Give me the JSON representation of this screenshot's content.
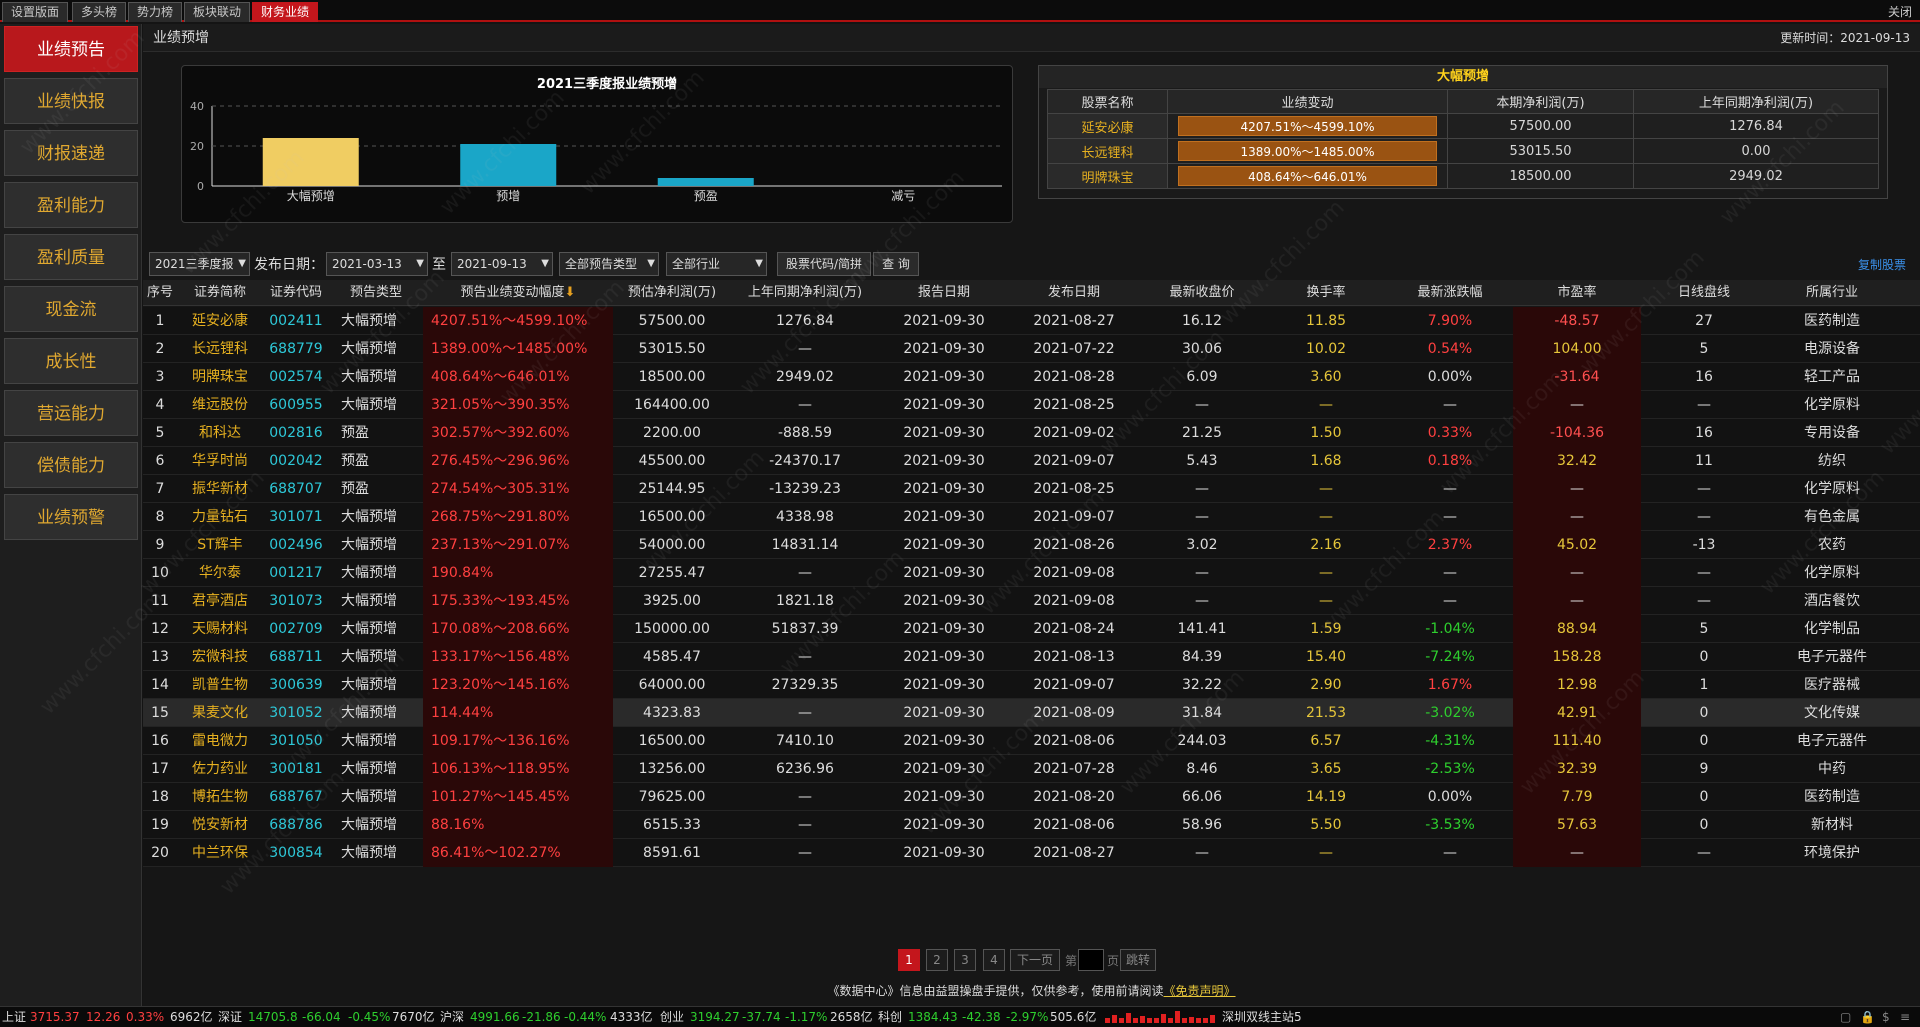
{
  "top_tabs": [
    {
      "label": "设置版面"
    },
    {
      "label": "多头榜"
    },
    {
      "label": "势力榜"
    },
    {
      "label": "板块联动"
    },
    {
      "label": "财务业绩"
    }
  ],
  "close_label": "关闭",
  "sidebar": [
    {
      "label": "业绩预告"
    },
    {
      "label": "业绩快报"
    },
    {
      "label": "财报速递"
    },
    {
      "label": "盈利能力"
    },
    {
      "label": "盈利质量"
    },
    {
      "label": "现金流"
    },
    {
      "label": "成长性"
    },
    {
      "label": "营运能力"
    },
    {
      "label": "偿债能力"
    },
    {
      "label": "业绩预警"
    }
  ],
  "page_title": "业绩预增",
  "update_time": "更新时间：2021-09-13",
  "watermark": "www.cfchi.com",
  "chart_data": {
    "type": "bar",
    "title": "2021三季度报业绩预增",
    "categories": [
      "大幅预增",
      "预增",
      "预盈",
      "减亏"
    ],
    "values": [
      24,
      21,
      4,
      0
    ],
    "colors": [
      "#f0cd62",
      "#1aa6c8",
      "#1aa6c8",
      "#1aa6c8"
    ],
    "ylim": [
      0,
      40
    ],
    "yticks": [
      "0",
      "20",
      "40"
    ],
    "grid": true
  },
  "summary": {
    "title": "大幅预增",
    "headers": [
      "股票名称",
      "业绩变动",
      "本期净利润(万)",
      "上年同期净利润(万)"
    ],
    "rows": [
      {
        "name": "延安必康",
        "change": "4207.51%～4599.10%",
        "profit": "57500.00",
        "prev": "1276.84",
        "fill": 1.0
      },
      {
        "name": "长远锂科",
        "change": "1389.00%～1485.00%",
        "profit": "53015.50",
        "prev": "0.00",
        "fill": 1.0
      },
      {
        "name": "明牌珠宝",
        "change": "408.64%～646.01%",
        "profit": "18500.00",
        "prev": "2949.02",
        "fill": 1.0
      }
    ]
  },
  "filters": {
    "period": "2021三季度报",
    "date_label": "发布日期：",
    "date_from": "2021-03-13",
    "to_label": "至",
    "date_to": "2021-09-13",
    "type": "全部预告类型",
    "industry": "全部行业",
    "search_placeholder": "股票代码/简拼",
    "query_label": "查 询",
    "copy_label": "复制股票"
  },
  "table_headers": [
    "序号",
    "证券简称",
    "证券代码",
    "预告类型",
    "预告业绩变动幅度",
    "预估净利润(万)",
    "上年同期净利润(万)",
    "报告日期",
    "发布日期",
    "最新收盘价",
    "换手率",
    "最新涨跌幅",
    "市盈率",
    "日线盘线",
    "所属行业"
  ],
  "sort_arrow": "⬇",
  "rows": [
    {
      "idx": "1",
      "name": "延安必康",
      "code": "002411",
      "type": "大幅预增",
      "range": "4207.51%～4599.10%",
      "est": "57500.00",
      "prev": "1276.84",
      "rdate": "2021-09-30",
      "pdate": "2021-08-27",
      "close": "16.12",
      "turn": "11.85",
      "chg": "7.90%",
      "dir": "up",
      "pe": "-48.57",
      "days": "27",
      "ind": "医药制造"
    },
    {
      "idx": "2",
      "name": "长远锂科",
      "code": "688779",
      "type": "大幅预增",
      "range": "1389.00%～1485.00%",
      "est": "53015.50",
      "prev": "—",
      "rdate": "2021-09-30",
      "pdate": "2021-07-22",
      "close": "30.06",
      "turn": "10.02",
      "chg": "0.54%",
      "dir": "up",
      "pe": "104.00",
      "days": "5",
      "ind": "电源设备"
    },
    {
      "idx": "3",
      "name": "明牌珠宝",
      "code": "002574",
      "type": "大幅预增",
      "range": "408.64%～646.01%",
      "est": "18500.00",
      "prev": "2949.02",
      "rdate": "2021-09-30",
      "pdate": "2021-08-28",
      "close": "6.09",
      "turn": "3.60",
      "chg": "0.00%",
      "dir": "flat",
      "pe": "-31.64",
      "days": "16",
      "ind": "轻工产品"
    },
    {
      "idx": "4",
      "name": "维远股份",
      "code": "600955",
      "type": "大幅预增",
      "range": "321.05%～390.35%",
      "est": "164400.00",
      "prev": "—",
      "rdate": "2021-09-30",
      "pdate": "2021-08-25",
      "close": "—",
      "turn": "—",
      "chg": "—",
      "dir": "flat",
      "pe": "—",
      "days": "—",
      "ind": "化学原料"
    },
    {
      "idx": "5",
      "name": "和科达",
      "code": "002816",
      "type": "预盈",
      "range": "302.57%～392.60%",
      "est": "2200.00",
      "prev": "-888.59",
      "rdate": "2021-09-30",
      "pdate": "2021-09-02",
      "close": "21.25",
      "turn": "1.50",
      "chg": "0.33%",
      "dir": "up",
      "pe": "-104.36",
      "days": "16",
      "ind": "专用设备"
    },
    {
      "idx": "6",
      "name": "华孚时尚",
      "code": "002042",
      "type": "预盈",
      "range": "276.45%～296.96%",
      "est": "45500.00",
      "prev": "-24370.17",
      "rdate": "2021-09-30",
      "pdate": "2021-09-07",
      "close": "5.43",
      "turn": "1.68",
      "chg": "0.18%",
      "dir": "up",
      "pe": "32.42",
      "days": "11",
      "ind": "纺织"
    },
    {
      "idx": "7",
      "name": "振华新材",
      "code": "688707",
      "type": "预盈",
      "range": "274.54%～305.31%",
      "est": "25144.95",
      "prev": "-13239.23",
      "rdate": "2021-09-30",
      "pdate": "2021-08-25",
      "close": "—",
      "turn": "—",
      "chg": "—",
      "dir": "flat",
      "pe": "—",
      "days": "—",
      "ind": "化学原料"
    },
    {
      "idx": "8",
      "name": "力量钻石",
      "code": "301071",
      "type": "大幅预增",
      "range": "268.75%～291.80%",
      "est": "16500.00",
      "prev": "4338.98",
      "rdate": "2021-09-30",
      "pdate": "2021-09-07",
      "close": "—",
      "turn": "—",
      "chg": "—",
      "dir": "flat",
      "pe": "—",
      "days": "—",
      "ind": "有色金属"
    },
    {
      "idx": "9",
      "name": "ST辉丰",
      "code": "002496",
      "type": "大幅预增",
      "range": "237.13%～291.07%",
      "est": "54000.00",
      "prev": "14831.14",
      "rdate": "2021-09-30",
      "pdate": "2021-08-26",
      "close": "3.02",
      "turn": "2.16",
      "chg": "2.37%",
      "dir": "up",
      "pe": "45.02",
      "days": "-13",
      "ind": "农药"
    },
    {
      "idx": "10",
      "name": "华尔泰",
      "code": "001217",
      "type": "大幅预增",
      "range": "190.84%",
      "est": "27255.47",
      "prev": "—",
      "rdate": "2021-09-30",
      "pdate": "2021-09-08",
      "close": "—",
      "turn": "—",
      "chg": "—",
      "dir": "flat",
      "pe": "—",
      "days": "—",
      "ind": "化学原料"
    },
    {
      "idx": "11",
      "name": "君亭酒店",
      "code": "301073",
      "type": "大幅预增",
      "range": "175.33%～193.45%",
      "est": "3925.00",
      "prev": "1821.18",
      "rdate": "2021-09-30",
      "pdate": "2021-09-08",
      "close": "—",
      "turn": "—",
      "chg": "—",
      "dir": "flat",
      "pe": "—",
      "days": "—",
      "ind": "酒店餐饮"
    },
    {
      "idx": "12",
      "name": "天赐材料",
      "code": "002709",
      "type": "大幅预增",
      "range": "170.08%～208.66%",
      "est": "150000.00",
      "prev": "51837.39",
      "rdate": "2021-09-30",
      "pdate": "2021-08-24",
      "close": "141.41",
      "turn": "1.59",
      "chg": "-1.04%",
      "dir": "down",
      "pe": "88.94",
      "days": "5",
      "ind": "化学制品"
    },
    {
      "idx": "13",
      "name": "宏微科技",
      "code": "688711",
      "type": "大幅预增",
      "range": "133.17%～156.48%",
      "est": "4585.47",
      "prev": "—",
      "rdate": "2021-09-30",
      "pdate": "2021-08-13",
      "close": "84.39",
      "turn": "15.40",
      "chg": "-7.24%",
      "dir": "down",
      "pe": "158.28",
      "days": "0",
      "ind": "电子元器件"
    },
    {
      "idx": "14",
      "name": "凯普生物",
      "code": "300639",
      "type": "大幅预增",
      "range": "123.20%～145.16%",
      "est": "64000.00",
      "prev": "27329.35",
      "rdate": "2021-09-30",
      "pdate": "2021-09-07",
      "close": "32.22",
      "turn": "2.90",
      "chg": "1.67%",
      "dir": "up",
      "pe": "12.98",
      "days": "1",
      "ind": "医疗器械"
    },
    {
      "idx": "15",
      "name": "果麦文化",
      "code": "301052",
      "type": "大幅预增",
      "range": "114.44%",
      "est": "4323.83",
      "prev": "—",
      "rdate": "2021-09-30",
      "pdate": "2021-08-09",
      "close": "31.84",
      "turn": "21.53",
      "chg": "-3.02%",
      "dir": "down",
      "pe": "42.91",
      "days": "0",
      "ind": "文化传媒"
    },
    {
      "idx": "16",
      "name": "雷电微力",
      "code": "301050",
      "type": "大幅预增",
      "range": "109.17%～136.16%",
      "est": "16500.00",
      "prev": "7410.10",
      "rdate": "2021-09-30",
      "pdate": "2021-08-06",
      "close": "244.03",
      "turn": "6.57",
      "chg": "-4.31%",
      "dir": "down",
      "pe": "111.40",
      "days": "0",
      "ind": "电子元器件"
    },
    {
      "idx": "17",
      "name": "佐力药业",
      "code": "300181",
      "type": "大幅预增",
      "range": "106.13%～118.95%",
      "est": "13256.00",
      "prev": "6236.96",
      "rdate": "2021-09-30",
      "pdate": "2021-07-28",
      "close": "8.46",
      "turn": "3.65",
      "chg": "-2.53%",
      "dir": "down",
      "pe": "32.39",
      "days": "9",
      "ind": "中药"
    },
    {
      "idx": "18",
      "name": "博拓生物",
      "code": "688767",
      "type": "大幅预增",
      "range": "101.27%～145.45%",
      "est": "79625.00",
      "prev": "—",
      "rdate": "2021-09-30",
      "pdate": "2021-08-20",
      "close": "66.06",
      "turn": "14.19",
      "chg": "0.00%",
      "dir": "flat",
      "pe": "7.79",
      "days": "0",
      "ind": "医药制造"
    },
    {
      "idx": "19",
      "name": "悦安新材",
      "code": "688786",
      "type": "大幅预增",
      "range": "88.16%",
      "est": "6515.33",
      "prev": "—",
      "rdate": "2021-09-30",
      "pdate": "2021-08-06",
      "close": "58.96",
      "turn": "5.50",
      "chg": "-3.53%",
      "dir": "down",
      "pe": "57.63",
      "days": "0",
      "ind": "新材料"
    },
    {
      "idx": "20",
      "name": "中兰环保",
      "code": "300854",
      "type": "大幅预增",
      "range": "86.41%～102.27%",
      "est": "8591.61",
      "prev": "—",
      "rdate": "2021-09-30",
      "pdate": "2021-08-27",
      "close": "—",
      "turn": "—",
      "chg": "—",
      "dir": "flat",
      "pe": "—",
      "days": "—",
      "ind": "环境保护"
    }
  ],
  "pager": {
    "pages": [
      "1",
      "2",
      "3",
      "4"
    ],
    "next": "下一页",
    "goto_prefix": "第",
    "goto_suffix": "页",
    "jump": "跳转"
  },
  "disclaimer": {
    "text": "《数据中心》信息由益盟操盘手提供，仅供参考，使用前请阅读",
    "link": "《免责声明》"
  },
  "status": {
    "sh_name": "上证",
    "sh_val": "3715.37",
    "sh_chg": "12.26",
    "sh_pct": "0.33%",
    "sh_amt": "6962亿",
    "sz_name": "深证",
    "sz_val": "14705.8",
    "sz_chg": "-66.04",
    "sz_pct": "-0.45%",
    "sz_amt": "7670亿",
    "hs_name": "沪深",
    "hs_val": "4991.66",
    "hs_chg": "-21.86",
    "hs_pct": "-0.44%",
    "hs_amt": "4333亿",
    "cy_name": "创业",
    "cy_val": "3194.27",
    "cy_chg": "-37.74",
    "cy_pct": "-1.17%",
    "cy_amt": "2658亿",
    "kc_name": "科创",
    "kc_val": "1384.43",
    "kc_chg": "-42.38",
    "kc_pct": "-2.97%",
    "kc_amt": "505.6亿",
    "server": "深圳双线主站5"
  }
}
